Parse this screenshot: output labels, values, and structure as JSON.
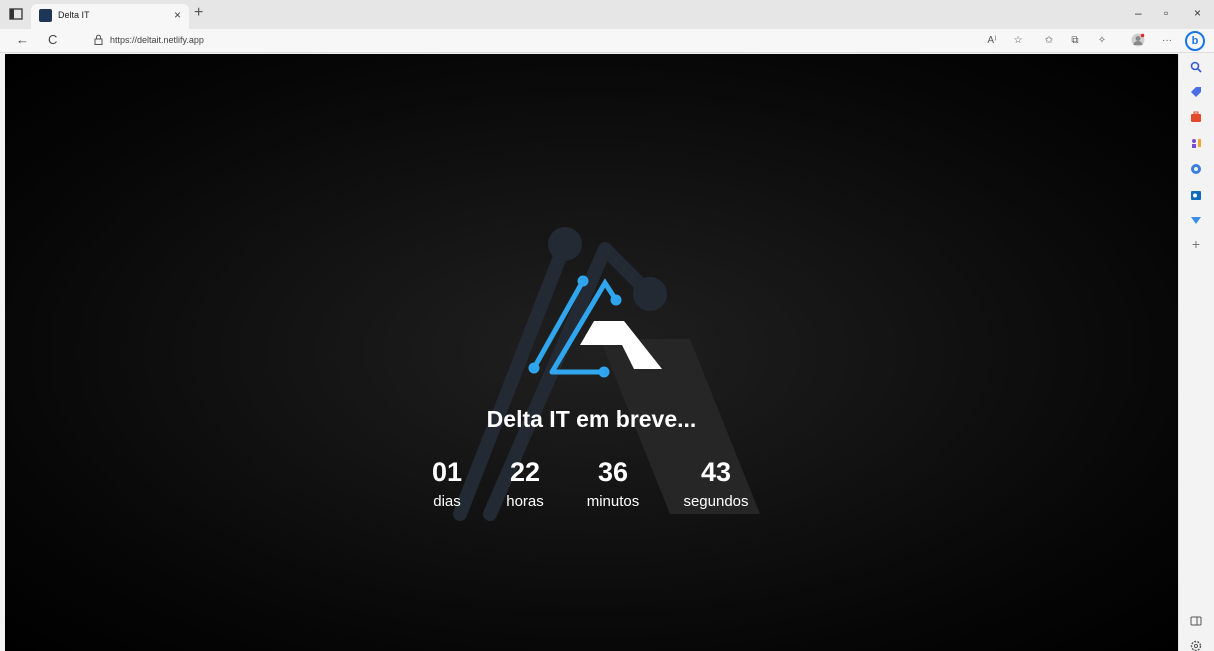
{
  "tab": {
    "title": "Delta IT",
    "close": "×",
    "new": "+"
  },
  "window": {
    "minimize": "–",
    "restore": "▫",
    "close": "×"
  },
  "nav": {
    "back": "←",
    "reload": "C"
  },
  "address": {
    "url": "https://deltait.netlify.app"
  },
  "toolbar": {
    "read_aloud": "A⁾",
    "favorites_star": "☆",
    "favorites": "✩",
    "collections": "⧉",
    "extensions": "✧",
    "more": "···"
  },
  "page": {
    "headline": "Delta IT em breve...",
    "countdown": [
      {
        "value": "01",
        "label": "dias"
      },
      {
        "value": "22",
        "label": "horas"
      },
      {
        "value": "36",
        "label": "minutos"
      },
      {
        "value": "43",
        "label": "segundos"
      }
    ]
  },
  "sidebar": {
    "add": "+"
  },
  "colors": {
    "accent": "#2fa6ee",
    "background": "#000000",
    "chrome": "#f3f3f3"
  }
}
